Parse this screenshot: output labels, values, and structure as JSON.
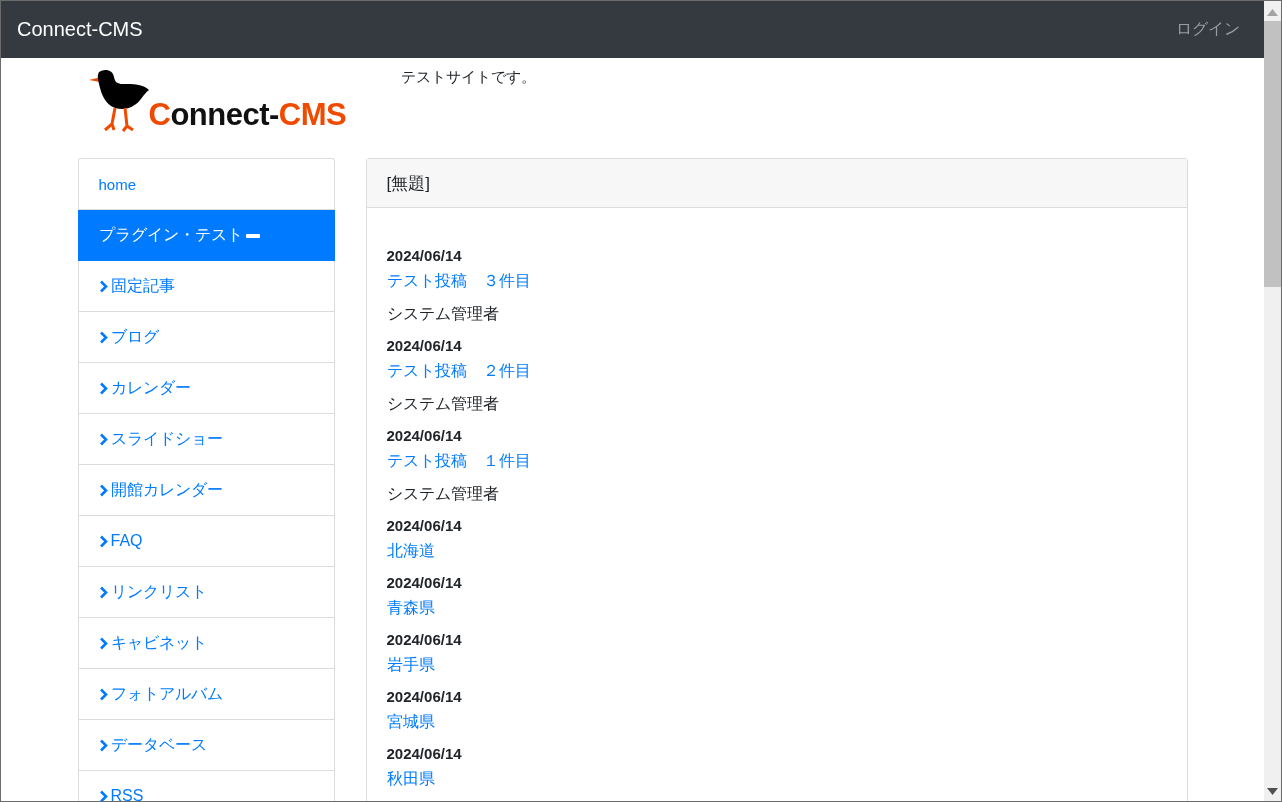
{
  "navbar": {
    "brand": "Connect-CMS",
    "login": "ログイン"
  },
  "header": {
    "logo": [
      {
        "text": "C",
        "accent": true
      },
      {
        "text": "onnect-",
        "accent": false
      },
      {
        "text": "CMS",
        "accent": true
      }
    ],
    "tagline": "テストサイトです。"
  },
  "menu": [
    {
      "label": "home",
      "selected": false
    },
    {
      "label": "プラグイン・テスト",
      "selected": true,
      "expanded": true,
      "children": [
        {
          "label": "固定記事",
          "selected": false
        },
        {
          "label": "ブログ",
          "selected": false
        },
        {
          "label": "カレンダー",
          "selected": false
        },
        {
          "label": "スライドショー",
          "selected": false
        },
        {
          "label": "開館カレンダー",
          "selected": false
        },
        {
          "label": "FAQ",
          "selected": false
        },
        {
          "label": "リンクリスト",
          "selected": false
        },
        {
          "label": "キャビネット",
          "selected": false
        },
        {
          "label": "フォトアルバム",
          "selected": false
        },
        {
          "label": "データベース",
          "selected": false
        },
        {
          "label": "RSS",
          "selected": false
        }
      ]
    }
  ],
  "card": {
    "title": "[無題]",
    "entries": [
      {
        "date": "2024/06/14",
        "title": "テスト投稿　３件目",
        "author": "システム管理者"
      },
      {
        "date": "2024/06/14",
        "title": "テスト投稿　２件目",
        "author": "システム管理者"
      },
      {
        "date": "2024/06/14",
        "title": "テスト投稿　１件目",
        "author": "システム管理者"
      },
      {
        "date": "2024/06/14",
        "title": "北海道"
      },
      {
        "date": "2024/06/14",
        "title": "青森県"
      },
      {
        "date": "2024/06/14",
        "title": "岩手県"
      },
      {
        "date": "2024/06/14",
        "title": "宮城県"
      },
      {
        "date": "2024/06/14",
        "title": "秋田県"
      }
    ]
  }
}
